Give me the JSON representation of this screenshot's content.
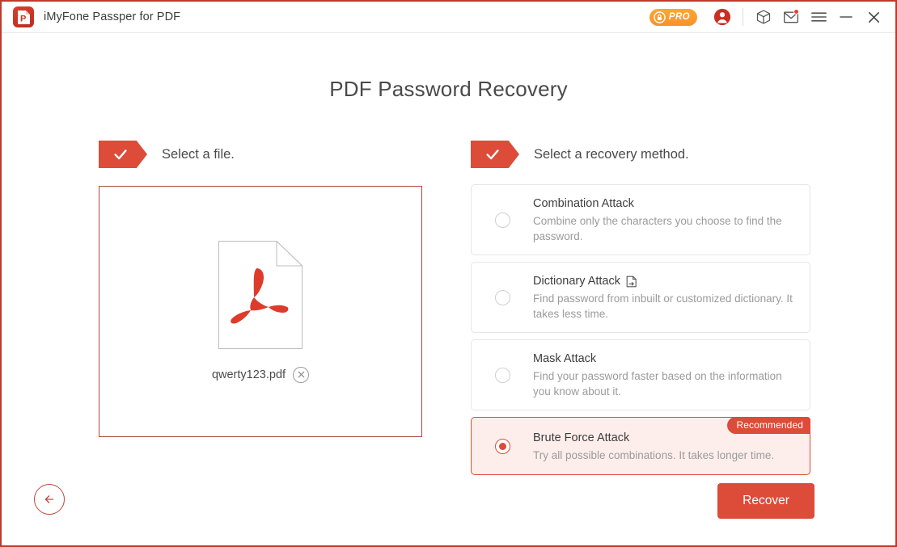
{
  "window": {
    "app_title": "iMyFone Passper for PDF",
    "logo_icon": "pdf-app-logo-icon",
    "accent_color": "#dd4b39",
    "border_color": "#c0392b"
  },
  "titlebar": {
    "pro_badge": {
      "label": "PRO",
      "icon": "lock-circle-icon",
      "color": "#f7922a"
    },
    "icons": [
      {
        "name": "account-icon",
        "glyph": "account"
      },
      {
        "name": "box-icon",
        "glyph": "box"
      },
      {
        "name": "mail-icon",
        "glyph": "mail",
        "has_notification": true
      },
      {
        "name": "menu-icon",
        "glyph": "hamburger"
      },
      {
        "name": "minimize-icon",
        "glyph": "minimize"
      },
      {
        "name": "close-icon",
        "glyph": "close"
      }
    ]
  },
  "main": {
    "page_title": "PDF Password Recovery",
    "step_file": {
      "check_icon": "check-icon",
      "label": "Select a file.",
      "file_icon": "adobe-pdf-icon",
      "file_name": "qwerty123.pdf",
      "remove_icon": "remove-file-icon"
    },
    "step_method": {
      "check_icon": "check-icon",
      "label": "Select a recovery method.",
      "options": [
        {
          "title": "Combination Attack",
          "description": "Combine only the characters you choose to find the password.",
          "selected": false,
          "badge": null,
          "extra_icon": null
        },
        {
          "title": "Dictionary Attack",
          "description": "Find password from inbuilt or customized dictionary. It takes less time.",
          "selected": false,
          "badge": null,
          "extra_icon": "import-dictionary-icon"
        },
        {
          "title": "Mask Attack",
          "description": "Find your password faster based on the information you know about it.",
          "selected": false,
          "badge": null,
          "extra_icon": null
        },
        {
          "title": "Brute Force Attack",
          "description": "Try all possible combinations. It takes longer time.",
          "selected": true,
          "badge": "Recommended",
          "extra_icon": null
        }
      ]
    },
    "footer": {
      "back_icon": "back-arrow-icon",
      "recover_label": "Recover"
    }
  }
}
